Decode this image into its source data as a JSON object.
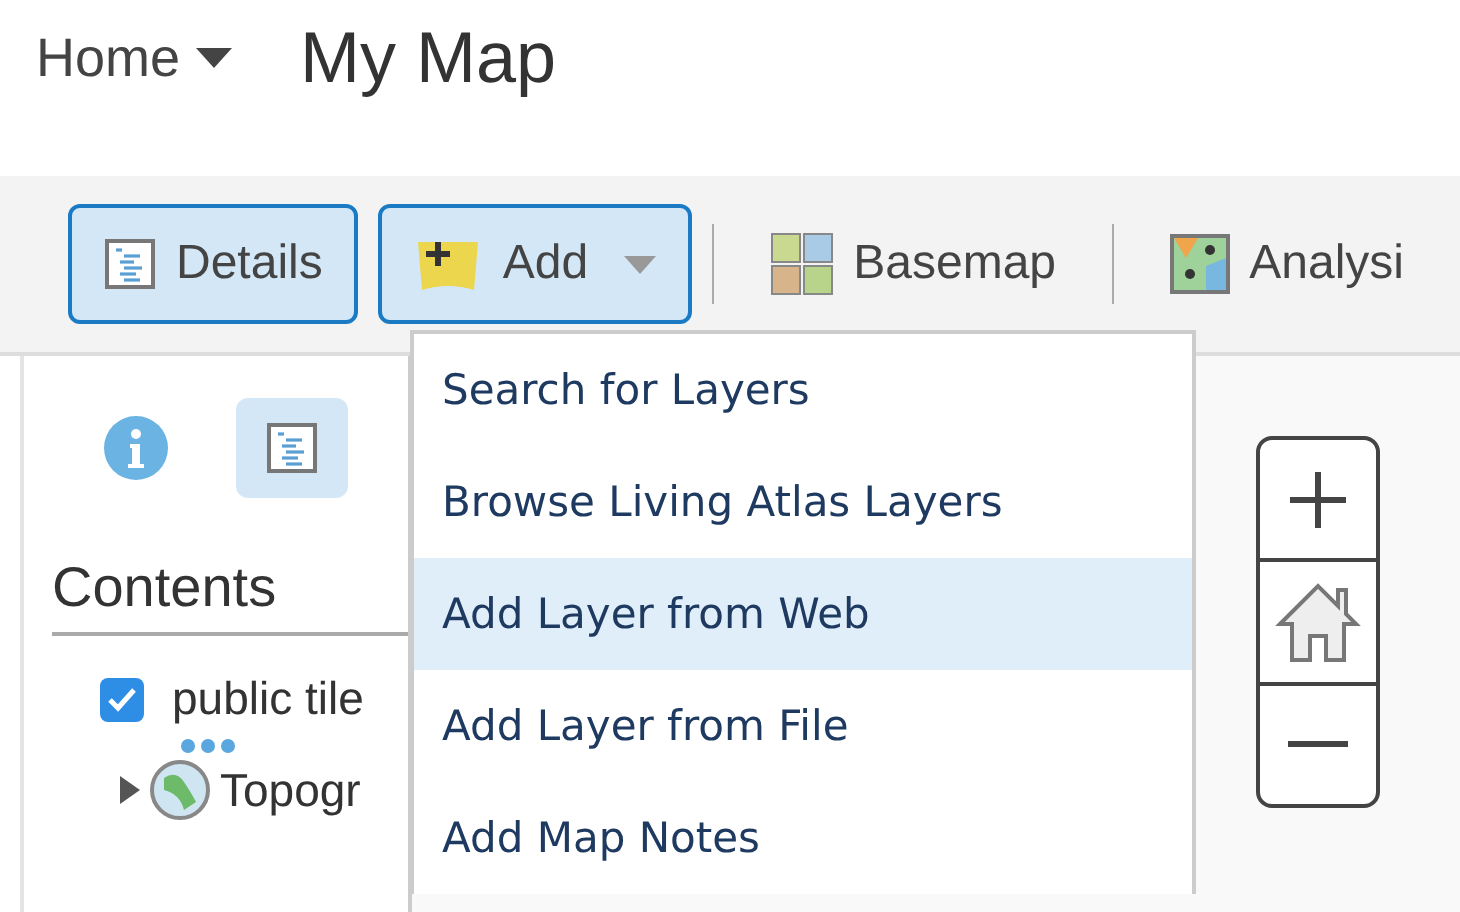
{
  "header": {
    "home_menu": "Home",
    "title": "My Map"
  },
  "toolbar": [
    {
      "label": "Details",
      "kind": "details",
      "selected": true
    },
    {
      "label": "Add",
      "kind": "add",
      "selected": true
    },
    {
      "label": "Basemap",
      "kind": "basemap",
      "selected": false
    },
    {
      "label": "Analysi",
      "kind": "analysis",
      "selected": false
    }
  ],
  "dropdown_menu": {
    "items": [
      {
        "label": "Search for Layers",
        "selected": false
      },
      {
        "label": "Browse Living Atlas Layers",
        "selected": false
      },
      {
        "label": "Add Layer from Web",
        "selected": true
      },
      {
        "label": "Add Layer from File",
        "selected": false
      },
      {
        "label": "Add Map Notes",
        "selected": false
      }
    ]
  },
  "sidebar": {
    "tabs": [
      {
        "kind": "info",
        "selected": false
      },
      {
        "kind": "details",
        "selected": true
      }
    ],
    "heading": "Contents",
    "layers": [
      {
        "kind": "checkbox",
        "name": "public tile",
        "checked": true
      },
      {
        "kind": "basemap",
        "name": "Topogr"
      }
    ]
  }
}
